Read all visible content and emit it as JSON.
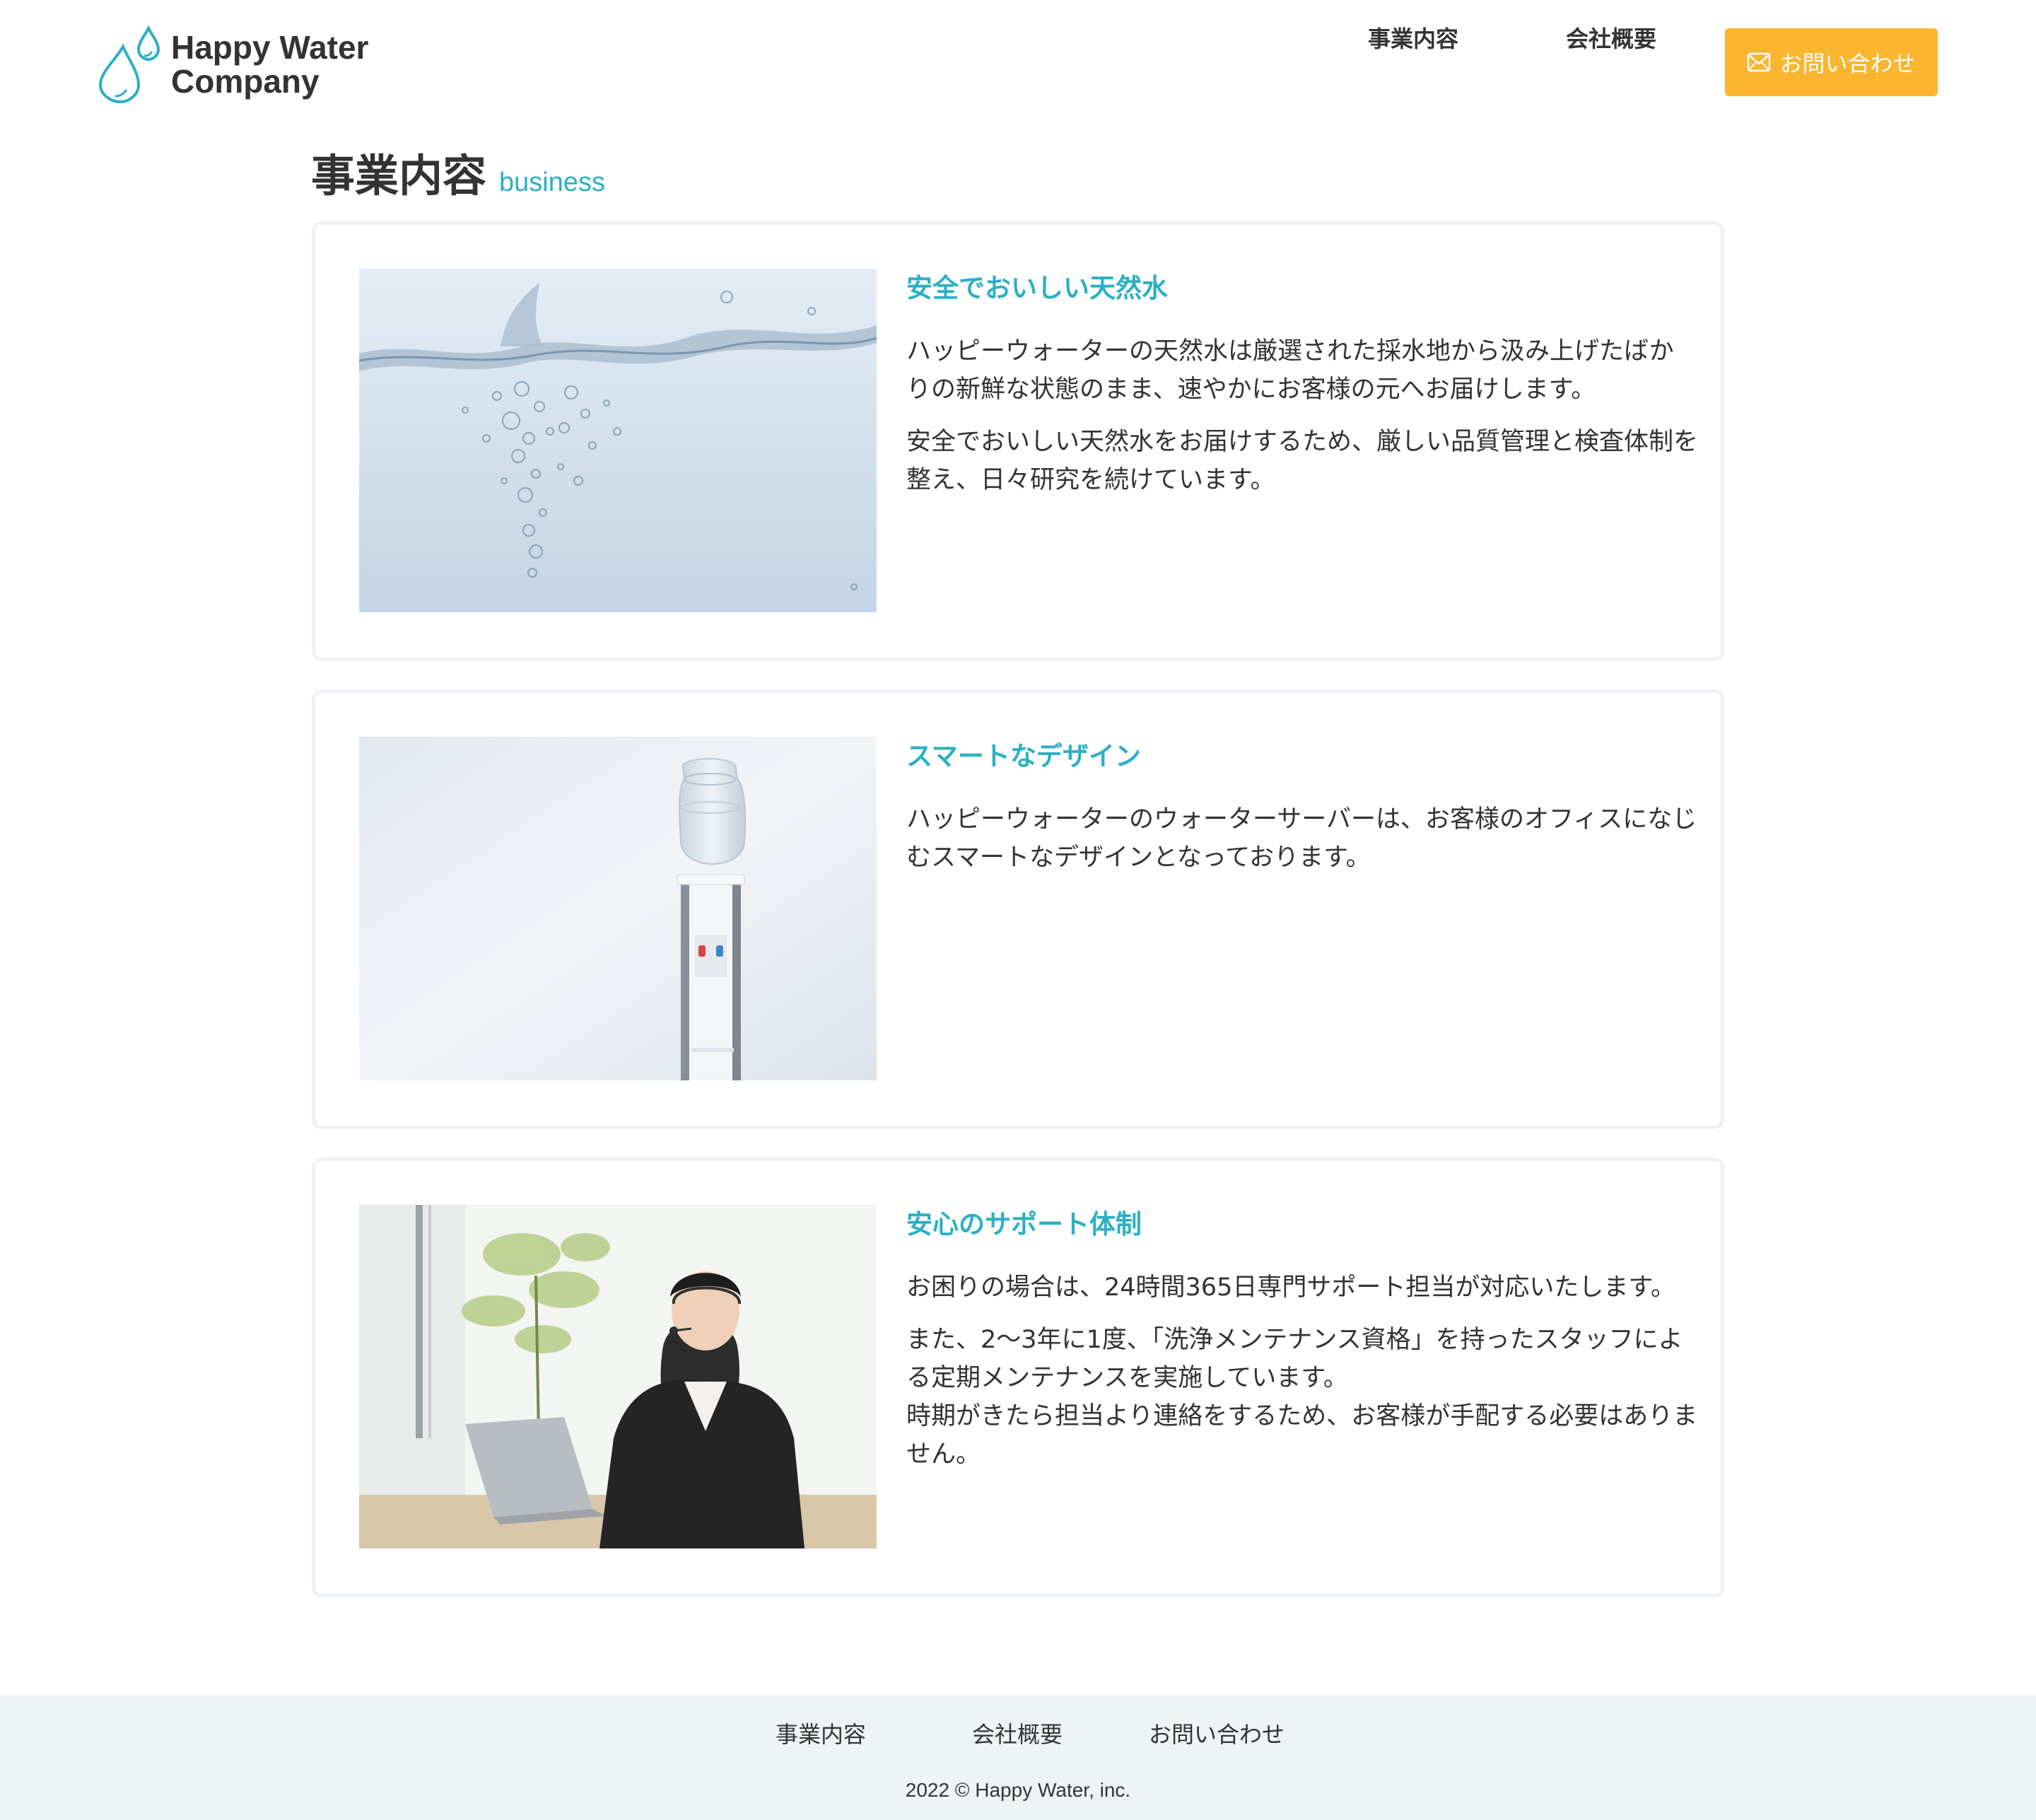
{
  "header": {
    "logo_line1": "Happy Water",
    "logo_line2": "Company",
    "nav": {
      "business": "事業内容",
      "company": "会社概要",
      "contact": "お問い合わせ"
    }
  },
  "section": {
    "title_jp": "事業内容",
    "title_en": "business"
  },
  "cards": [
    {
      "heading": "安全でおいしい天然水",
      "paragraphs": [
        "ハッピーウォーターの天然水は厳選された採水地から汲み上げたばかりの新鮮な状態のまま、速やかにお客様の元へお届けします。",
        "安全でおいしい天然水をお届けするため、厳しい品質管理と検査体制を整え、日々研究を続けています。"
      ],
      "image": "water-splash-bubbles"
    },
    {
      "heading": "スマートなデザイン",
      "paragraphs": [
        "ハッピーウォーターのウォーターサーバーは、お客様のオフィスになじむスマートなデザインとなっております。"
      ],
      "image": "water-server-office"
    },
    {
      "heading": "安心のサポート体制",
      "paragraphs": [
        "お困りの場合は、24時間365日専門サポート担当が対応いたします。",
        "また、2〜3年に1度、「洗浄メンテナンス資格」を持ったスタッフによる定期メンテナンスを実施しています。",
        "時期がきたら担当より連絡をするため、お客様が手配する必要はありません。"
      ],
      "image": "support-operator-headset"
    }
  ],
  "footer": {
    "nav": {
      "business": "事業内容",
      "company": "会社概要",
      "contact": "お問い合わせ"
    },
    "copyright": "2022 © Happy Water, inc."
  },
  "colors": {
    "accent": "#2bb0c3",
    "button": "#fbb52f",
    "card_border": "#eef2f5",
    "footer_bg": "#eef4f6",
    "text": "#333333"
  }
}
